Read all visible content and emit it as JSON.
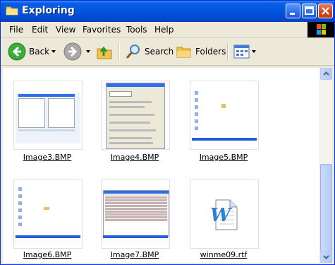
{
  "window": {
    "title": "Exploring"
  },
  "menu": [
    "File",
    "Edit",
    "View",
    "Favorites",
    "Tools",
    "Help"
  ],
  "toolbar": {
    "back_label": "Back",
    "search_label": "Search",
    "folders_label": "Folders"
  },
  "files": [
    {
      "name": "Image3.BMP"
    },
    {
      "name": "Image4.BMP"
    },
    {
      "name": "Image5.BMP"
    },
    {
      "name": "Image6.BMP"
    },
    {
      "name": "Image7.BMP"
    },
    {
      "name": "winme09.rtf"
    }
  ],
  "colors": {
    "title_bar": "#0355e0",
    "window_bg": "#ece9d8",
    "taskbar": "#245edb"
  }
}
